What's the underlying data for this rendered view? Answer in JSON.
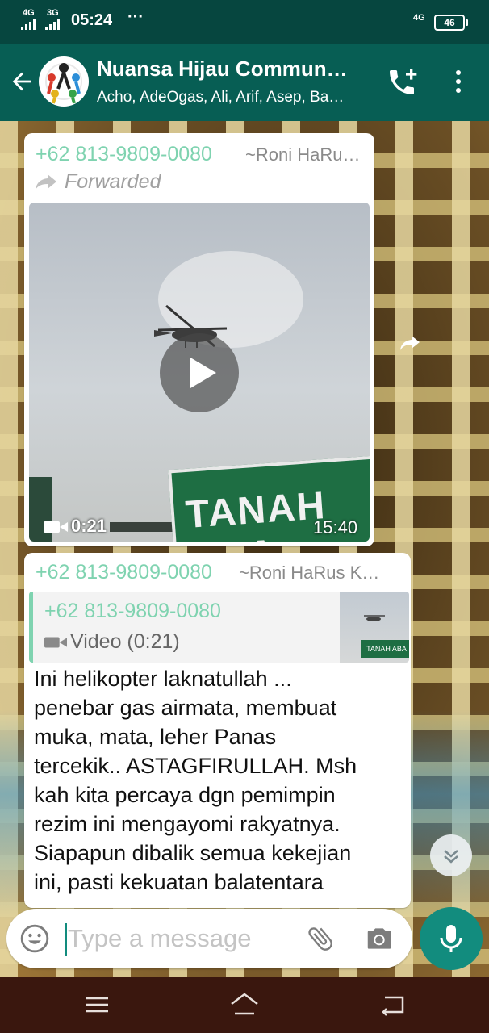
{
  "status_bar": {
    "network1": "4G",
    "network2": "3G",
    "time": "05:24",
    "more": "···",
    "right_network": "4G",
    "battery": "46"
  },
  "header": {
    "title": "Nuansa Hijau Commun…",
    "subtitle": "Acho, AdeOgas, Ali, Arif, Asep, Ba…",
    "icons": [
      "back-arrow-icon",
      "group-avatar",
      "add-call-icon",
      "more-vert-icon"
    ]
  },
  "messages": [
    {
      "sender": "+62 813-9809-0080",
      "push_name": "~Roni HaRu…",
      "forwarded_label": "Forwarded",
      "video": {
        "sign_text": "TANAH ABA",
        "duration": "0:21",
        "time": "15:40"
      }
    },
    {
      "sender": "+62 813-9809-0080",
      "push_name": "~Roni HaRus K…",
      "quoted": {
        "sender": "+62 813-9809-0080",
        "type_label": "Video (0:21)",
        "thumb_text": "TANAH ABA"
      },
      "text": "Ini helikopter laknatullah ...\npenebar gas airmata, membuat\nmuka, mata, leher Panas\ntercekik.. ASTAGFIRULLAH. Msh\nkah kita percaya dgn pemimpin\nrezim ini mengayomi rakyatnya.\nSiapapun dibalik semua kekejian\nini, pasti kekuatan balatentara"
    }
  ],
  "composer": {
    "placeholder": "Type a message",
    "icons": [
      "emoji-icon",
      "attach-icon",
      "camera-icon",
      "mic-icon"
    ]
  },
  "nav_bar": {
    "icons": [
      "menu-icon",
      "home-icon",
      "back-icon"
    ]
  },
  "colors": {
    "status_bar": "#06463f",
    "app_bar": "#075e54",
    "accent": "#128c7e",
    "sender_name": "#7fd3b0",
    "nav_bar": "#3a170e"
  }
}
